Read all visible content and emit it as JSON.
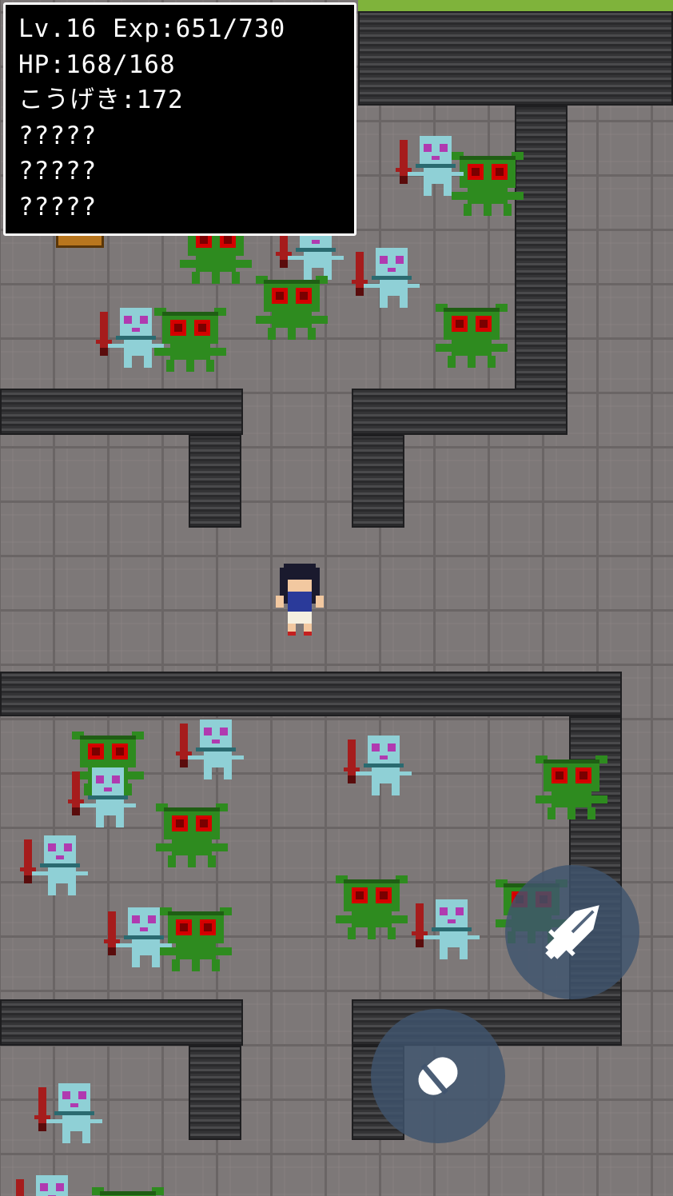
{
  "stats": {
    "level_label": "Lv.16",
    "exp_label": "Exp:651/730",
    "hp_label": "HP:168/168",
    "attack_label": "こうげき:172",
    "hidden_1": "?????",
    "hidden_2": "?????",
    "hidden_3": "?????"
  },
  "actions": {
    "attack_icon": "sword-icon",
    "item_icon": "capsule-icon"
  },
  "colors": {
    "floor": "#7d7878",
    "wall": "#3a3a3c",
    "goblin": "#2e8b1f",
    "goblin_eyes": "#d40000",
    "skeleton": "#8fd0d6",
    "sword": "#a61c1c",
    "grass": "#7fb33b",
    "button": "#40546e"
  }
}
